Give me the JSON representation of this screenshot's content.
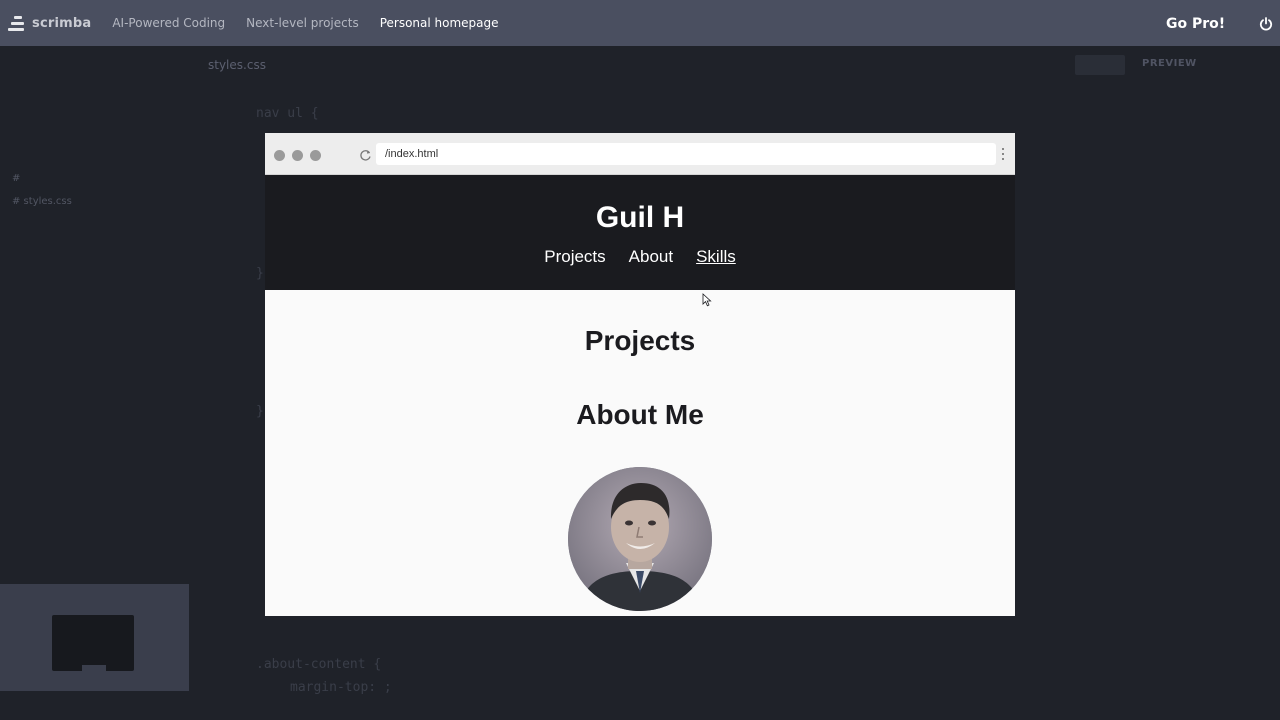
{
  "topbar": {
    "brand": "scrimba",
    "breadcrumbs": [
      "AI-Powered Coding",
      "Next-level projects",
      "Personal homepage"
    ],
    "cta": "Go Pro!",
    "icons": [
      "scrimba-logo-icon",
      "power-icon"
    ]
  },
  "editor": {
    "file_tab": "styles.css",
    "sidebar_file": "# styles.css",
    "sidebar_hash": "#",
    "preview_label": "PREVIEW",
    "code_lines": [
      "nav ul {",
      "}",
      "}",
      ".about-content {",
      "margin-top: ;"
    ]
  },
  "browser": {
    "url": "/index.html",
    "site_title": "Guil H",
    "nav": [
      "Projects",
      "About",
      "Skills"
    ],
    "hovered_nav": "Skills",
    "sections": [
      "Projects",
      "About Me"
    ],
    "avatar_alt": "Profile photo",
    "icons": [
      "reload-icon",
      "kebab-menu-icon",
      "pointer-cursor-icon"
    ]
  },
  "colors": {
    "topbar": "#4a4f60",
    "site_header": "#1a1b1f",
    "page_bg": "#fafafa"
  }
}
